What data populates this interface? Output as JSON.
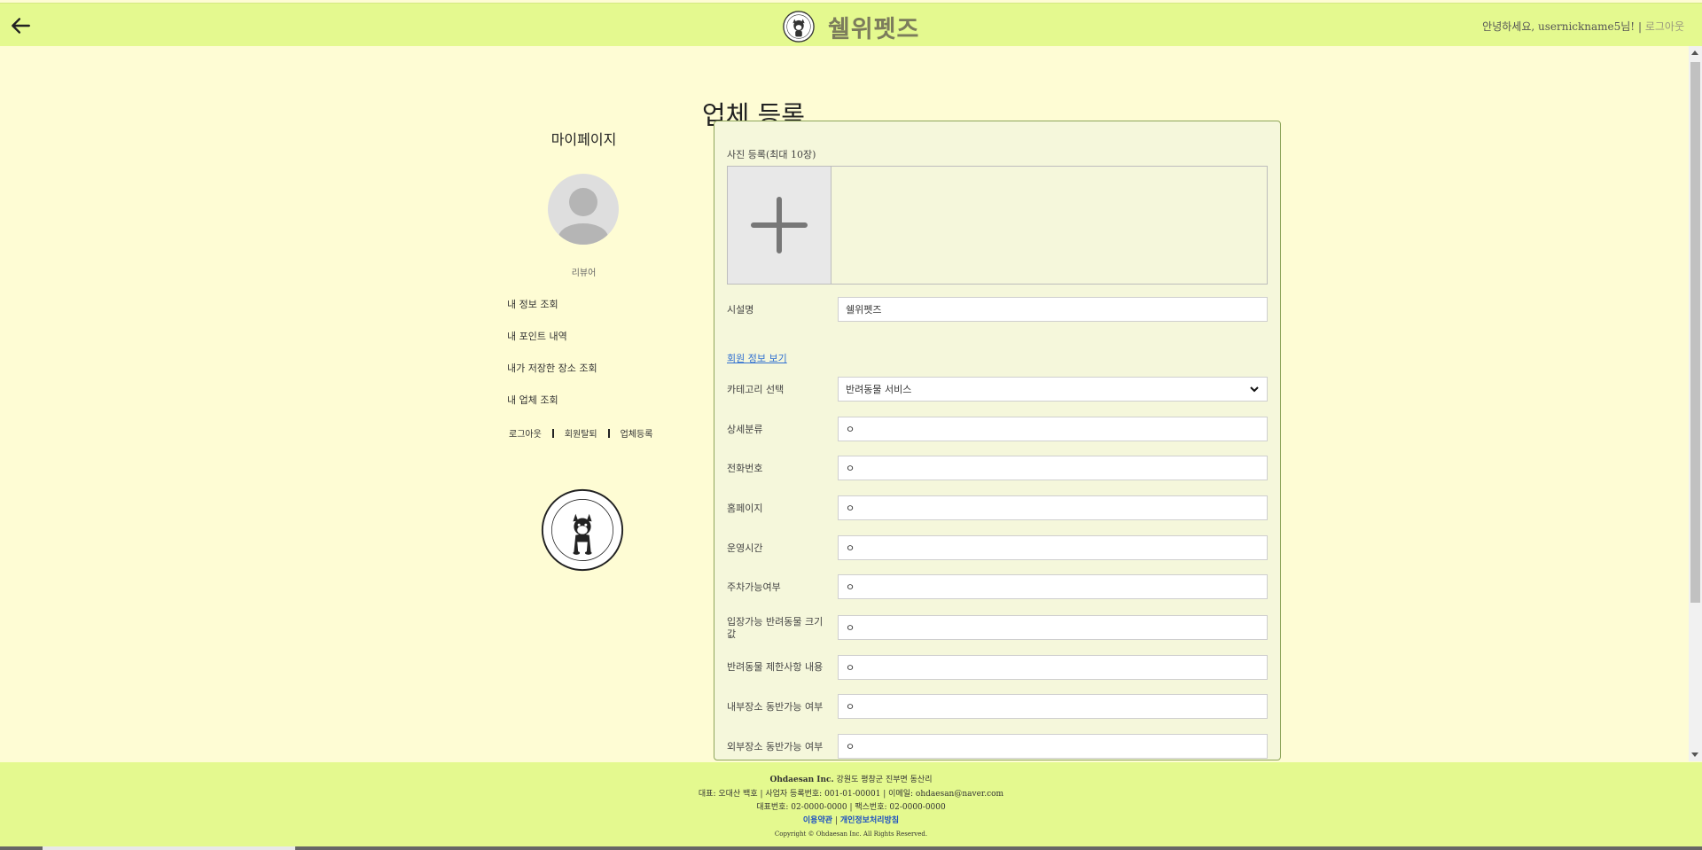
{
  "header": {
    "brand_title": "쉘위펫즈",
    "greeting": "안녕하세요, usernickname5님! |",
    "logout": "로그아웃"
  },
  "page_title": "업체 등록",
  "sidebar": {
    "title": "마이페이지",
    "role": "리뷰어",
    "menu": [
      "내 정보 조회",
      "내 포인트 내역",
      "내가 저장한 장소 조회",
      "내 업체 조회"
    ],
    "links": [
      "로그아웃",
      "회원탈퇴",
      "업체등록"
    ]
  },
  "form": {
    "photo_label": "사진 등록(최대 10장)",
    "facility_name_label": "시설명",
    "facility_name_value": "쉘위펫즈",
    "member_info_link": "회원 정보 보기",
    "category_label": "카테고리 선택",
    "category_value": "반려동물 서비스",
    "fields": [
      {
        "label": "상세분류",
        "value": "ㅇ"
      },
      {
        "label": "전화번호",
        "value": "ㅇ"
      },
      {
        "label": "홈페이지",
        "value": "ㅇ"
      },
      {
        "label": "운영시간",
        "value": "ㅇ"
      },
      {
        "label": "주차가능여부",
        "value": "ㅇ"
      },
      {
        "label": "입장가능 반려동물 크기 값",
        "value": "ㅇ"
      },
      {
        "label": "반려동물 제한사항 내용",
        "value": "ㅇ"
      },
      {
        "label": "내부장소 동반가능 여부",
        "value": "ㅇ"
      },
      {
        "label": "외부장소 동반가능 여부",
        "value": "ㅇ"
      }
    ]
  },
  "footer": {
    "company": "Ohdaesan Inc.",
    "address": "강원도 평창군 진부면 동산리",
    "line2": "대표: 오대산 백호  |  사업자 등록번호: 001-01-00001  |  이메일: ohdaesan@naver.com",
    "line3": "대표번호: 02-0000-0000  |  팩스번호: 02-0000-0000",
    "terms": "이용약관",
    "privacy": "개인정보처리방침",
    "link_sep": "|",
    "copyright": "Copyright © Ohdaesan Inc. All Rights Reserved."
  }
}
